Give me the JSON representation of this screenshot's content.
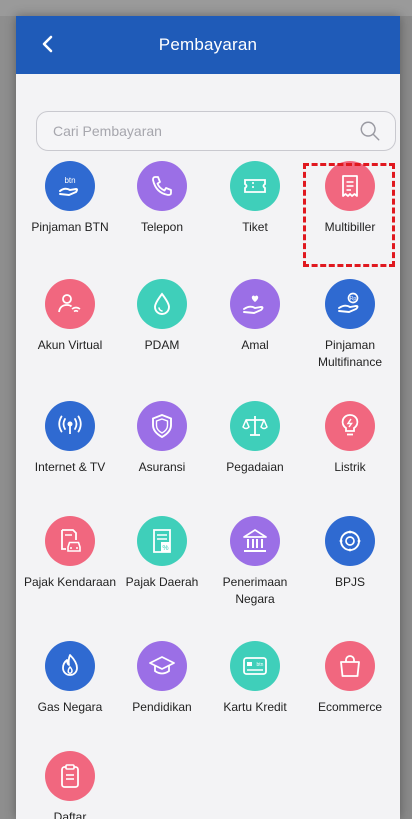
{
  "header": {
    "title": "Pembayaran",
    "back_icon": "chevron-left-icon"
  },
  "search": {
    "placeholder": "Cari Pembayaran",
    "icon": "search-icon"
  },
  "items": [
    {
      "label": "Pinjaman BTN",
      "icon": "btn-loan-icon",
      "color": "#2f6ad1"
    },
    {
      "label": "Telepon",
      "icon": "phone-icon",
      "color": "#9b6fe6"
    },
    {
      "label": "Tiket",
      "icon": "ticket-icon",
      "color": "#3fcfba"
    },
    {
      "label": "Multibiller",
      "icon": "receipt-icon",
      "color": "#f1677f"
    },
    {
      "label": "Akun Virtual",
      "icon": "user-wifi-icon",
      "color": "#f1677f"
    },
    {
      "label": "PDAM",
      "icon": "water-drop-icon",
      "color": "#3fcfba"
    },
    {
      "label": "Amal",
      "icon": "charity-hand-icon",
      "color": "#9b6fe6"
    },
    {
      "label": "Pinjaman Multifinance",
      "icon": "coin-hand-icon",
      "color": "#2f6ad1"
    },
    {
      "label": "Internet & TV",
      "icon": "broadcast-icon",
      "color": "#2f6ad1"
    },
    {
      "label": "Asuransi",
      "icon": "shield-icon",
      "color": "#9b6fe6"
    },
    {
      "label": "Pegadaian",
      "icon": "scale-icon",
      "color": "#3fcfba"
    },
    {
      "label": "Listrik",
      "icon": "lightbulb-icon",
      "color": "#f1677f"
    },
    {
      "label": "Pajak Kendaraan",
      "icon": "car-document-icon",
      "color": "#f1677f"
    },
    {
      "label": "Pajak Daerah",
      "icon": "tax-document-icon",
      "color": "#3fcfba"
    },
    {
      "label": "Penerimaan Negara",
      "icon": "government-building-icon",
      "color": "#9b6fe6"
    },
    {
      "label": "BPJS",
      "icon": "bpjs-icon",
      "color": "#2f6ad1"
    },
    {
      "label": "Gas Negara",
      "icon": "flame-icon",
      "color": "#2f6ad1"
    },
    {
      "label": "Pendidikan",
      "icon": "graduation-cap-icon",
      "color": "#9b6fe6"
    },
    {
      "label": "Kartu Kredit",
      "icon": "credit-card-icon",
      "color": "#3fcfba"
    },
    {
      "label": "Ecommerce",
      "icon": "shopping-bag-icon",
      "color": "#f1677f"
    },
    {
      "label": "Daftar Pembayaran",
      "icon": "clipboard-icon",
      "color": "#f1677f"
    }
  ]
}
